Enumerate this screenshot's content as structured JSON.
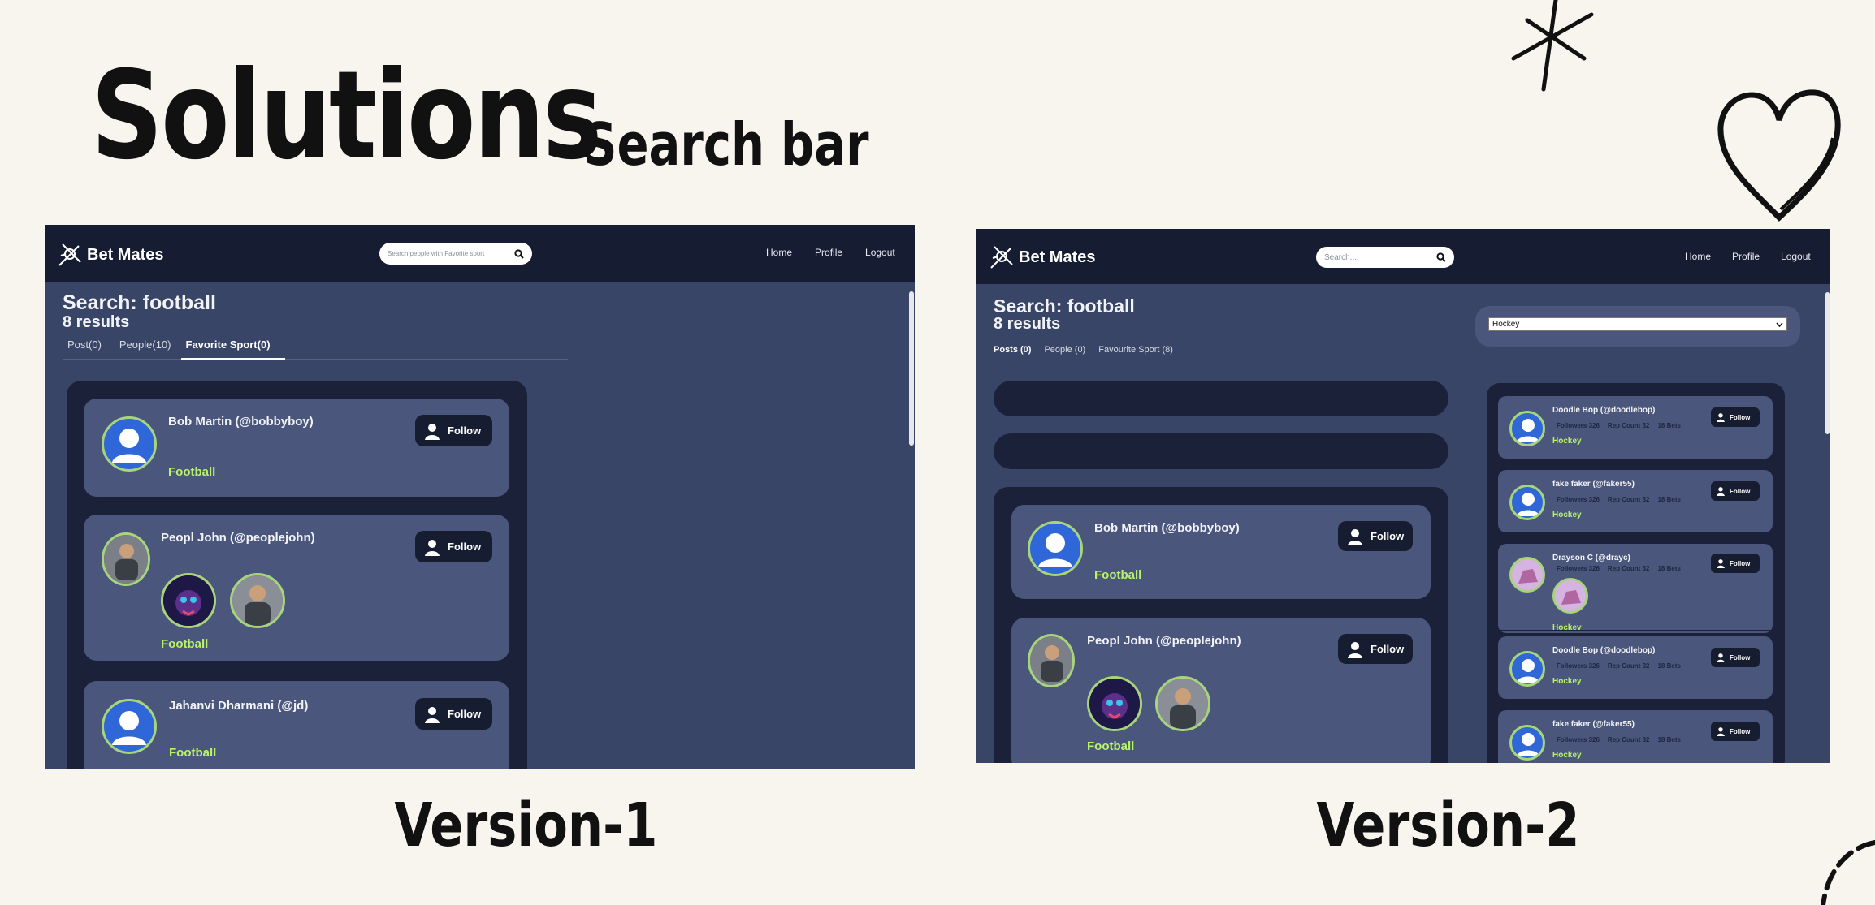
{
  "heading": {
    "title": "Solutions",
    "subtitle": "Search bar"
  },
  "labels": {
    "v1": "Version-1",
    "v2": "Version-2"
  },
  "colors": {
    "background": "#f8f5ee",
    "navbar": "#161d33",
    "panel": "#394567",
    "card": "#4a567b",
    "accent_green": "#b9f36a",
    "avatar_blue": "#2f66d8"
  },
  "v1": {
    "brand": "Bet Mates",
    "search_placeholder": "Search people with Favorite sport",
    "nav": {
      "home": "Home",
      "profile": "Profile",
      "logout": "Logout"
    },
    "search_title": "Search: football",
    "results": "8 results",
    "tabs": [
      "Post(0)",
      "People(10)",
      "Favorite Sport(0)"
    ],
    "cards": [
      {
        "name": "Bob Martin (@bobbyboy)",
        "sport": "Football",
        "follow": "Follow"
      },
      {
        "name": "Peopl John (@peoplejohn)",
        "sport": "Football",
        "follow": "Follow"
      },
      {
        "name": "Jahanvi Dharmani (@jd)",
        "sport": "Football",
        "follow": "Follow"
      }
    ]
  },
  "v2": {
    "brand": "Bet Mates",
    "search_placeholder": "Search...",
    "nav": {
      "home": "Home",
      "profile": "Profile",
      "logout": "Logout"
    },
    "search_title": "Search: football",
    "results": "8 results",
    "tabs": [
      "Posts (0)",
      "People (0)",
      "Favourite Sport (8)"
    ],
    "filter_value": "Hockey",
    "cards": [
      {
        "name": "Bob Martin (@bobbyboy)",
        "sport": "Football",
        "follow": "Follow"
      },
      {
        "name": "Peopl John (@peoplejohn)",
        "sport": "Football",
        "follow": "Follow"
      }
    ],
    "side_cards": [
      {
        "name": "Doodle Bop (@doodlebop)",
        "followers": "Followers 326",
        "rep": "Rep Count 32",
        "bets": "18 Bets",
        "sport": "Hockey",
        "follow": "Follow"
      },
      {
        "name": "fake faker (@faker55)",
        "followers": "Followers 326",
        "rep": "Rep Count 32",
        "bets": "18 Bets",
        "sport": "Hockey",
        "follow": "Follow"
      },
      {
        "name": "Drayson C (@drayc)",
        "followers": "Followers 326",
        "rep": "Rep Count 32",
        "bets": "18 Bets",
        "sport": "Hockey",
        "follow": "Follow"
      },
      {
        "name": "Doodle Bop (@doodlebop)",
        "followers": "Followers 326",
        "rep": "Rep Count 32",
        "bets": "18 Bets",
        "sport": "Hockey",
        "follow": "Follow"
      },
      {
        "name": "fake faker (@faker55)",
        "followers": "Followers 326",
        "rep": "Rep Count 32",
        "bets": "18 Bets",
        "sport": "Hockey",
        "follow": "Follow"
      }
    ]
  }
}
